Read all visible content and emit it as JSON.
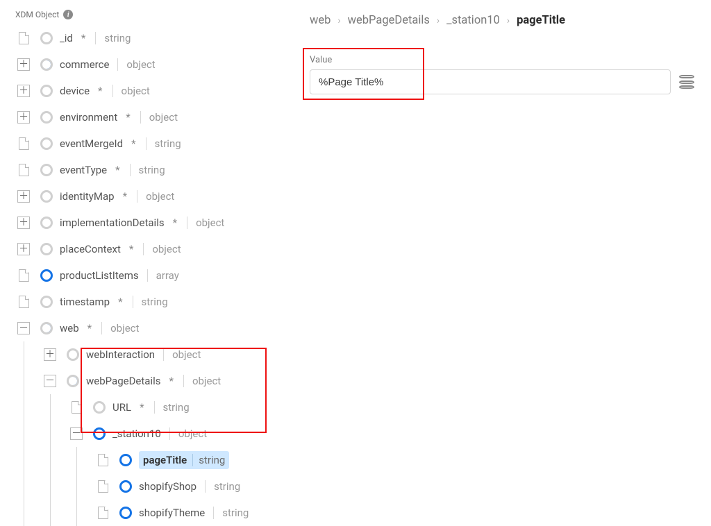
{
  "header": {
    "title": "XDM Object"
  },
  "tree": [
    {
      "icon": "doc",
      "status": "empty",
      "name": "_id",
      "asterisk": true,
      "type": "string",
      "depth": 0
    },
    {
      "icon": "plus",
      "status": "partial",
      "name": "commerce",
      "asterisk": false,
      "type": "object",
      "depth": 0
    },
    {
      "icon": "plus",
      "status": "empty",
      "name": "device",
      "asterisk": true,
      "type": "object",
      "depth": 0
    },
    {
      "icon": "plus",
      "status": "empty",
      "name": "environment",
      "asterisk": true,
      "type": "object",
      "depth": 0
    },
    {
      "icon": "doc",
      "status": "empty",
      "name": "eventMergeId",
      "asterisk": true,
      "type": "string",
      "depth": 0
    },
    {
      "icon": "doc",
      "status": "empty",
      "name": "eventType",
      "asterisk": true,
      "type": "string",
      "depth": 0
    },
    {
      "icon": "plus",
      "status": "empty",
      "name": "identityMap",
      "asterisk": true,
      "type": "object",
      "depth": 0
    },
    {
      "icon": "plus",
      "status": "empty",
      "name": "implementationDetails",
      "asterisk": true,
      "type": "object",
      "depth": 0
    },
    {
      "icon": "plus",
      "status": "empty",
      "name": "placeContext",
      "asterisk": true,
      "type": "object",
      "depth": 0
    },
    {
      "icon": "doc",
      "status": "full",
      "name": "productListItems",
      "asterisk": false,
      "type": "array",
      "depth": 0
    },
    {
      "icon": "doc",
      "status": "empty",
      "name": "timestamp",
      "asterisk": true,
      "type": "string",
      "depth": 0
    },
    {
      "icon": "minus",
      "status": "partial",
      "name": "web",
      "asterisk": true,
      "type": "object",
      "depth": 0
    },
    {
      "icon": "plus",
      "status": "empty",
      "name": "webInteraction",
      "asterisk": false,
      "type": "object",
      "depth": 1
    },
    {
      "icon": "minus",
      "status": "partial",
      "name": "webPageDetails",
      "asterisk": true,
      "type": "object",
      "depth": 1
    },
    {
      "icon": "doc",
      "status": "empty",
      "name": "URL",
      "asterisk": true,
      "type": "string",
      "depth": 2
    },
    {
      "icon": "minus",
      "status": "full",
      "name": "_station10",
      "asterisk": false,
      "type": "object",
      "depth": 2
    },
    {
      "icon": "doc",
      "status": "full",
      "name": "pageTitle",
      "asterisk": false,
      "type": "string",
      "depth": 3,
      "selected": true
    },
    {
      "icon": "doc",
      "status": "full",
      "name": "shopifyShop",
      "asterisk": false,
      "type": "string",
      "depth": 3
    },
    {
      "icon": "doc",
      "status": "full",
      "name": "shopifyTheme",
      "asterisk": false,
      "type": "string",
      "depth": 3
    }
  ],
  "breadcrumb": [
    "web",
    "webPageDetails",
    "_station10",
    "pageTitle"
  ],
  "value": {
    "label": "Value",
    "text": "%Page Title%"
  },
  "glyphs": {
    "plus": "＋",
    "minus": "－",
    "caret": "›"
  }
}
